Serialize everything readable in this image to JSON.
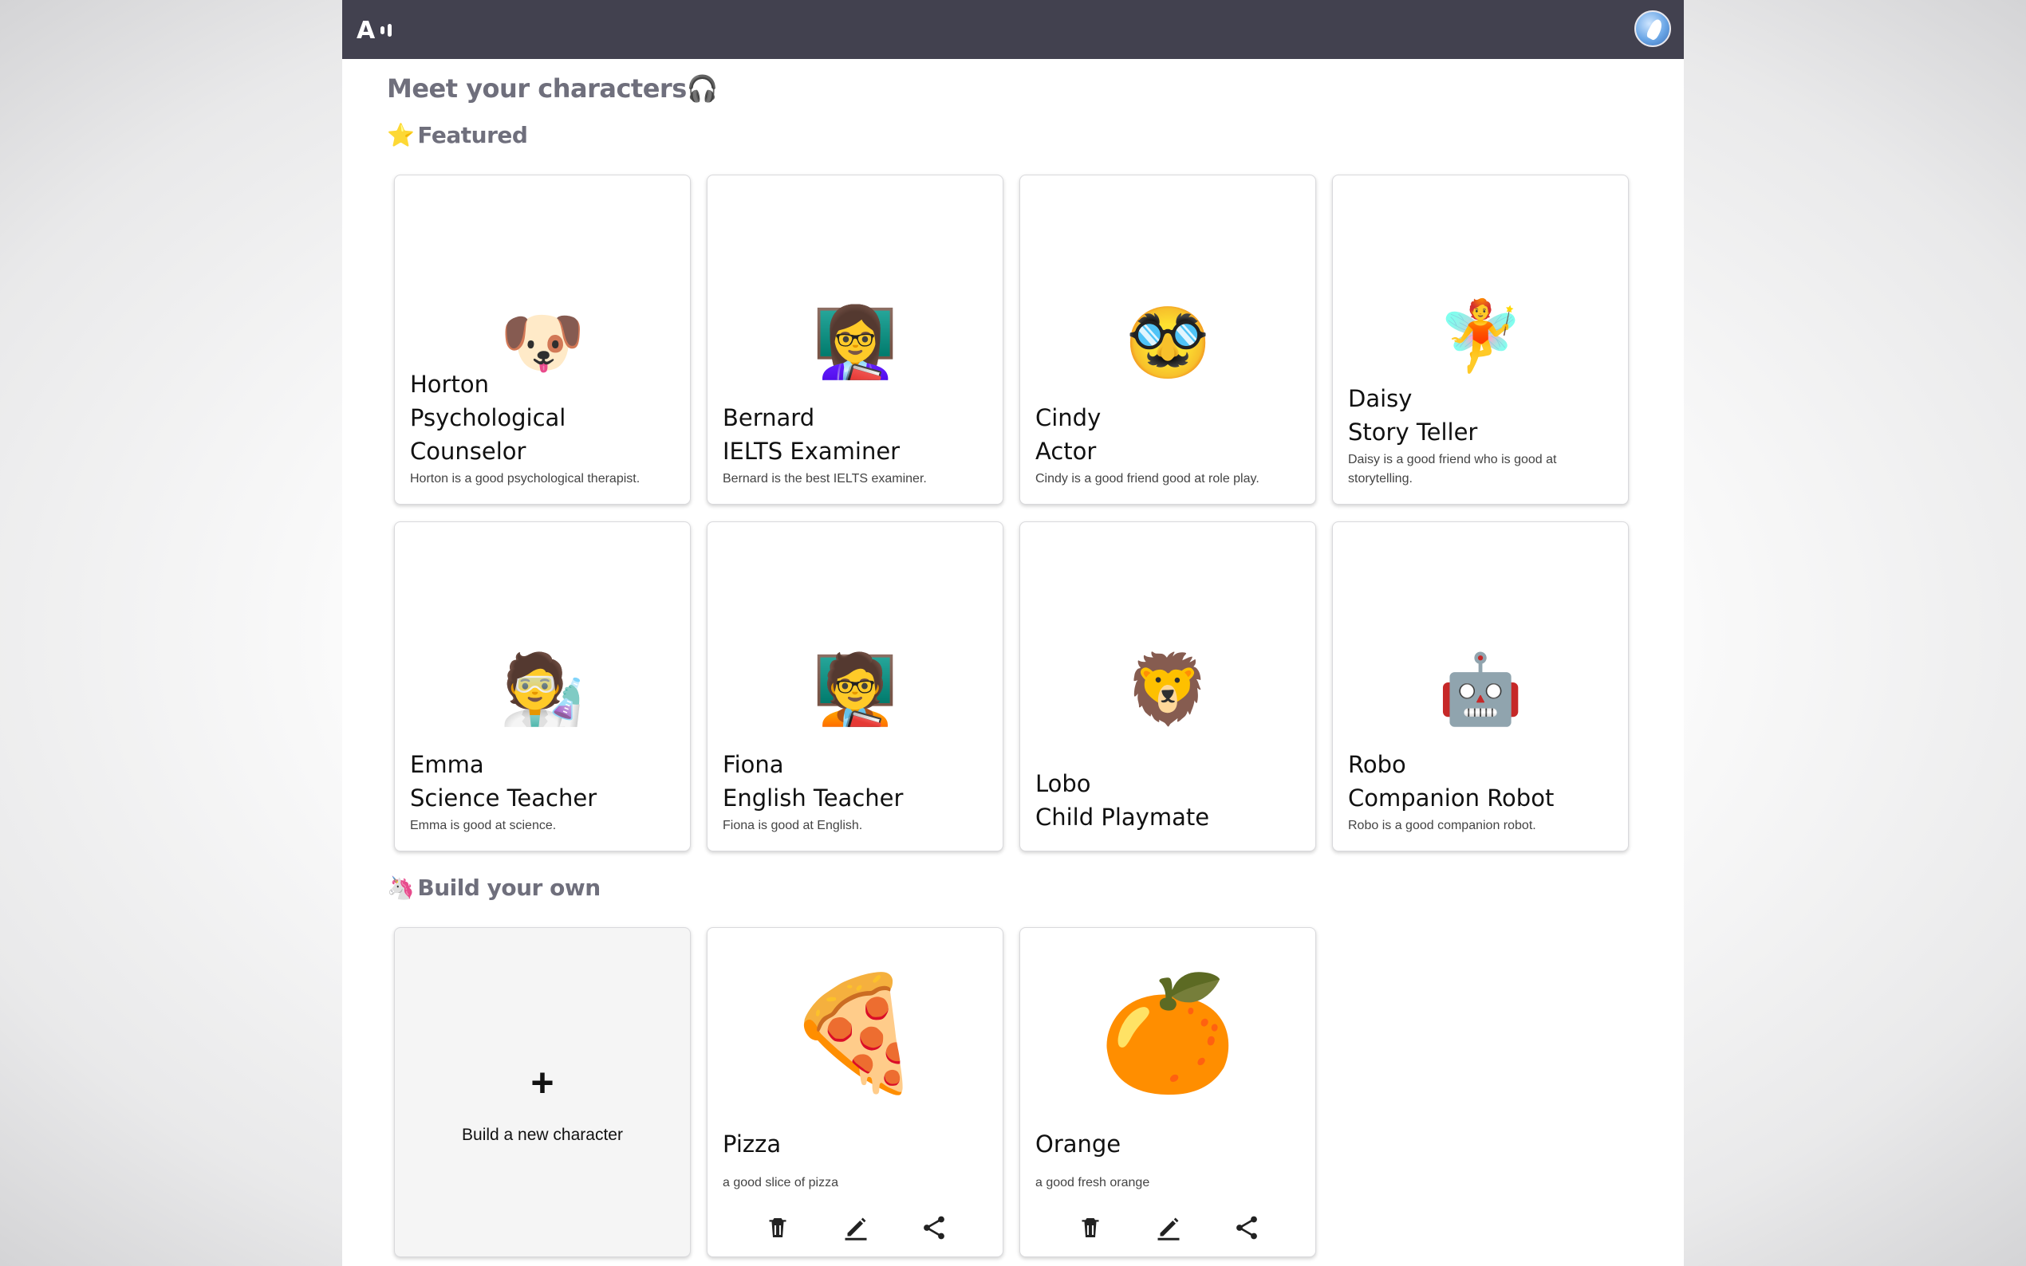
{
  "header": {
    "logo_text": "A",
    "avatar": "user-avatar"
  },
  "page_title": "Meet your characters🎧",
  "featured": {
    "title": "Featured",
    "icon": "⭐",
    "cards": [
      {
        "emoji": "🐶",
        "name": "Horton",
        "role": "Psychological Counselor",
        "desc": "Horton is a good psychological therapist."
      },
      {
        "emoji": "👩‍🏫",
        "name": "Bernard",
        "role": "IELTS Examiner",
        "desc": "Bernard is the best IELTS examiner."
      },
      {
        "emoji": "🥸",
        "name": "Cindy",
        "role": "Actor",
        "desc": "Cindy is a good friend good at role play."
      },
      {
        "emoji": "🧚",
        "name": "Daisy",
        "role": "Story Teller",
        "desc": "Daisy is a good friend who is good at storytelling."
      },
      {
        "emoji": "🧑‍🔬",
        "name": "Emma",
        "role": "Science Teacher",
        "desc": "Emma is good at science."
      },
      {
        "emoji": "🧑‍🏫",
        "name": "Fiona",
        "role": "English Teacher",
        "desc": "Fiona is good at English."
      },
      {
        "emoji": "🦁",
        "name": "Lobo",
        "role": "Child Playmate",
        "desc": ""
      },
      {
        "emoji": "🤖",
        "name": "Robo",
        "role": "Companion Robot",
        "desc": "Robo is a good companion robot."
      }
    ]
  },
  "build_own": {
    "title": "Build your own",
    "icon": "🦄",
    "new_card": {
      "plus": "+",
      "label": "Build a new character"
    },
    "cards": [
      {
        "emoji": "🍕",
        "name": "Pizza",
        "desc": "a good slice of pizza",
        "actions": [
          "delete-icon",
          "edit-icon",
          "share-icon"
        ]
      },
      {
        "emoji": "🍊",
        "name": "Orange",
        "desc": "a good fresh orange",
        "actions": [
          "delete-icon",
          "edit-icon",
          "share-icon"
        ]
      }
    ]
  },
  "colors": {
    "topbar": "#42414f",
    "title_gray": "#6f6f7c",
    "card_border": "#d9d9dc",
    "new_card_bg": "#f5f5f5"
  }
}
